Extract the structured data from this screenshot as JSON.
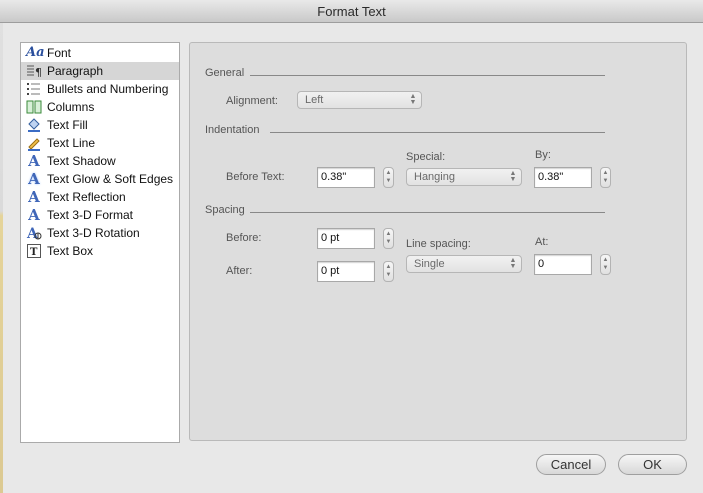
{
  "window": {
    "title": "Format Text"
  },
  "sidebar": {
    "items": [
      {
        "label": "Font",
        "icon": "font-icon",
        "selected": false
      },
      {
        "label": "Paragraph",
        "icon": "paragraph-icon",
        "selected": true
      },
      {
        "label": "Bullets and Numbering",
        "icon": "bullets-icon",
        "selected": false
      },
      {
        "label": "Columns",
        "icon": "columns-icon",
        "selected": false
      },
      {
        "label": "Text Fill",
        "icon": "paint-bucket-icon",
        "selected": false
      },
      {
        "label": "Text Line",
        "icon": "pencil-icon",
        "selected": false
      },
      {
        "label": "Text Shadow",
        "icon": "text-shadow-icon",
        "selected": false
      },
      {
        "label": "Text Glow & Soft Edges",
        "icon": "text-glow-icon",
        "selected": false
      },
      {
        "label": "Text Reflection",
        "icon": "text-reflection-icon",
        "selected": false
      },
      {
        "label": "Text 3-D Format",
        "icon": "text-3d-format-icon",
        "selected": false
      },
      {
        "label": "Text 3-D Rotation",
        "icon": "text-3d-rotation-icon",
        "selected": false
      },
      {
        "label": "Text Box",
        "icon": "text-box-icon",
        "selected": false
      }
    ]
  },
  "panel": {
    "general": {
      "heading": "General",
      "alignment_label": "Alignment:",
      "alignment_value": "Left"
    },
    "indentation": {
      "heading": "Indentation",
      "before_text_label": "Before Text:",
      "before_text_value": "0.38\"",
      "special_label": "Special:",
      "special_value": "Hanging",
      "by_label": "By:",
      "by_value": "0.38\""
    },
    "spacing": {
      "heading": "Spacing",
      "before_label": "Before:",
      "before_value": "0 pt",
      "after_label": "After:",
      "after_value": "0 pt",
      "line_spacing_label": "Line spacing:",
      "line_spacing_value": "Single",
      "at_label": "At:",
      "at_value": "0"
    }
  },
  "buttons": {
    "cancel": "Cancel",
    "ok": "OK"
  }
}
